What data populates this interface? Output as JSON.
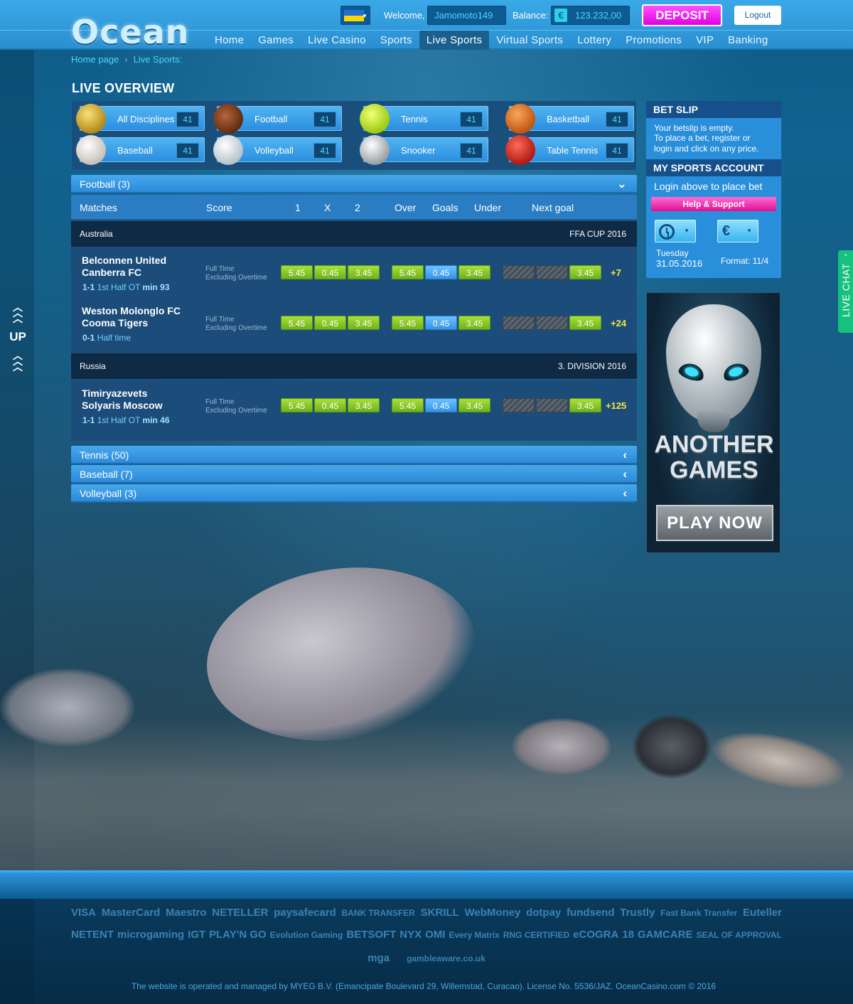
{
  "header": {
    "logo_text": "Ocean",
    "welcome_label": "Welcome,",
    "username": "Jamomoto149",
    "balance_label": "Balance:",
    "currency_symbol": "€",
    "balance": "123.232,00",
    "deposit_label": "DEPOSIT",
    "logout_label": "Logout",
    "nav": [
      "Home",
      "Games",
      "Live Casino",
      "Sports",
      "Live Sports",
      "Virtual Sports",
      "Lottery",
      "Promotions",
      "VIP",
      "Banking"
    ],
    "active_nav": "Live Sports"
  },
  "breadcrumb": [
    "Home page",
    "Live Sports:"
  ],
  "page_title": "LIVE OVERVIEW",
  "disciplines": [
    {
      "label": "All Disciplines",
      "count": "41",
      "icon": "trophy-icon"
    },
    {
      "label": "Football",
      "count": "41",
      "icon": "american-football-icon"
    },
    {
      "label": "Tennis",
      "count": "41",
      "icon": "tennis-ball-icon"
    },
    {
      "label": "Basketball",
      "count": "41",
      "icon": "basketball-icon"
    },
    {
      "label": "Baseball",
      "count": "41",
      "icon": "baseball-icon"
    },
    {
      "label": "Volleyball",
      "count": "41",
      "icon": "volleyball-icon"
    },
    {
      "label": "Snooker",
      "count": "41",
      "icon": "soccer-ball-icon"
    },
    {
      "label": "Table Tennis",
      "count": "41",
      "icon": "ping-pong-icon"
    }
  ],
  "football_section": {
    "title": "Football (3)",
    "columns": [
      "Matches",
      "Score",
      "1",
      "X",
      "2",
      "Over",
      "Goals",
      "Under",
      "Next goal"
    ],
    "leagues": [
      {
        "country": "Australia",
        "tournament": "FFA CUP 2016",
        "matches": [
          {
            "home": "Belconnen United",
            "away": "Canberra FC",
            "score": "1-1",
            "status": "1st Half OT",
            "minute": "min 93",
            "period_line1": "Full Time",
            "period_line2": "Excluding Overtime",
            "odds": [
              "5.45",
              "0.45",
              "3.45"
            ],
            "goals": [
              "5.45",
              "0.45",
              "3.45"
            ],
            "next_goal": "3.45",
            "more": "+7"
          },
          {
            "home": "Weston Molonglo FC",
            "away": "Cooma Tigers",
            "score": "0-1",
            "status": "Half time",
            "minute": "",
            "period_line1": "Full Time",
            "period_line2": "Excluding Overtime",
            "odds": [
              "5.45",
              "0.45",
              "3.45"
            ],
            "goals": [
              "5.45",
              "0.45",
              "3.45"
            ],
            "next_goal": "3.45",
            "more": "+24"
          }
        ]
      },
      {
        "country": "Russia",
        "tournament": "3. DIVISION 2016",
        "matches": [
          {
            "home": "Timiryazevets",
            "away": "Solyaris Moscow",
            "score": "1-1",
            "status": "1st Half OT",
            "minute": "min 46",
            "period_line1": "Full Time",
            "period_line2": "Excluding Overtime",
            "odds": [
              "5.45",
              "0.45",
              "3.45"
            ],
            "goals": [
              "5.45",
              "0.45",
              "3.45"
            ],
            "next_goal": "3.45",
            "more": "+125"
          }
        ]
      }
    ]
  },
  "collapsed_sections": [
    "Tennis (50)",
    "Baseball (7)",
    "Volleyball (3)"
  ],
  "betslip": {
    "title": "BET SLIP",
    "line1": "Your betslip is empty.",
    "line2": "To place a bet, register or",
    "line3": "login  and click on any price."
  },
  "account": {
    "title": "MY SPORTS ACCOUNT",
    "prompt": "Login above to place bet",
    "help_label": "Help & Support",
    "day": "Tuesday",
    "date": "31.05.2016",
    "format": "Format: 11/4",
    "currency_symbol": "€"
  },
  "ad": {
    "line1": "ANOTHER",
    "line2": "GAMES",
    "button": "PLAY NOW"
  },
  "side": {
    "up_label": "UP",
    "live_chat_label": "LIVE CHAT"
  },
  "footer": {
    "payment_row1": [
      "VISA",
      "MasterCard",
      "Maestro",
      "NETELLER",
      "paysafecard",
      "BANK TRANSFER",
      "SKRILL",
      "WebMoney",
      "dotpay",
      "fundsend",
      "Trustly",
      "Fast Bank Transfer",
      "Euteller"
    ],
    "payment_row2": [
      "NETENT",
      "microgaming",
      "IGT",
      "PLAY'N GO",
      "Evolution Gaming",
      "BETSOFT",
      "NYX",
      "OMI",
      "Every Matrix",
      "RNG CERTIFIED",
      "eCOGRA",
      "18",
      "GAMCARE",
      "SEAL OF APPROVAL"
    ],
    "payment_row3": [
      "mga",
      "gambleaware.co.uk"
    ],
    "legal": "The website is operated and managed by MYEG B.V. (Emancipate Boulevard 29, Willemstad, Curacao). License No. 5536/JAZ. OceanCasino.com © 2016"
  }
}
